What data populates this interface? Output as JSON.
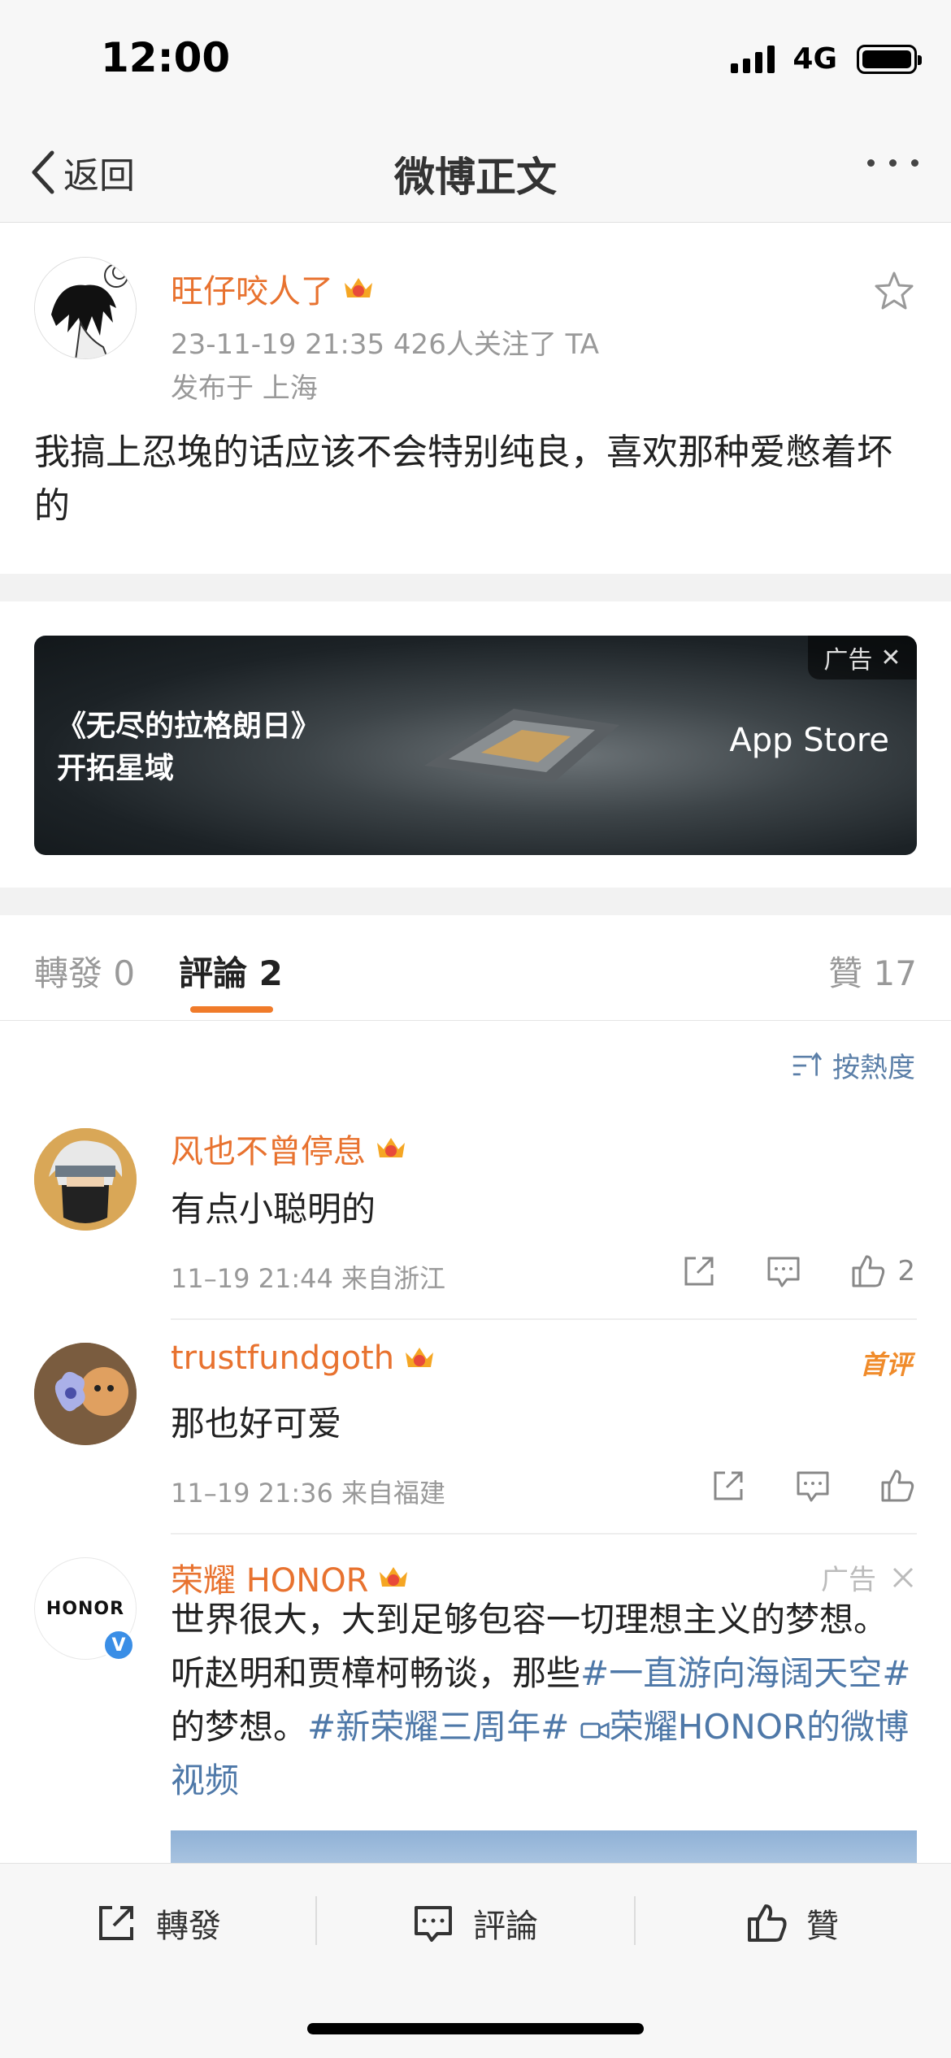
{
  "status_bar": {
    "time": "12:00",
    "network": "4G"
  },
  "nav": {
    "back_label": "返回",
    "title": "微博正文"
  },
  "post": {
    "author": "旺仔咬人了",
    "meta": "23-11-19 21:35  426人关注了 TA",
    "location": "发布于 上海",
    "text": "我搞上忍堍的话应该不会特别纯良，喜欢那种爱憋着坏的"
  },
  "ad_banner": {
    "title_line1": "《无尽的拉格朗日》",
    "title_line2": "开拓星域",
    "store": "App Store",
    "tag": "广告"
  },
  "tabs": {
    "repost": "轉發 0",
    "comment": "評論 2",
    "like": "贊 17"
  },
  "sort_label": "按熱度",
  "comments": [
    {
      "name": "风也不曾停息",
      "text": "有点小聪明的",
      "meta": "11–19 21:44  来自浙江",
      "likes": "2"
    },
    {
      "name": "trustfundgoth",
      "text": "那也好可爱",
      "meta": "11–19 21:36  来自福建",
      "badge": "首评"
    }
  ],
  "ad_comment": {
    "name": "荣耀 HONOR",
    "avatar_text": "HONOR",
    "tag": "广告",
    "text_plain1": "世界很大，大到足够包容一切理想主义的梦想。听赵明和贾樟柯畅谈，那些",
    "link1": "#一直游向海阔天空#",
    "text_plain2": "的梦想。",
    "link2": "#新荣耀三周年#",
    "link3": "荣耀HONOR的微博视频"
  },
  "bottom_bar": {
    "repost": "轉發",
    "comment": "評論",
    "like": "贊"
  },
  "colors": {
    "accent": "#e8722f",
    "link": "#4e78a8",
    "underline": "#f07b2a"
  }
}
